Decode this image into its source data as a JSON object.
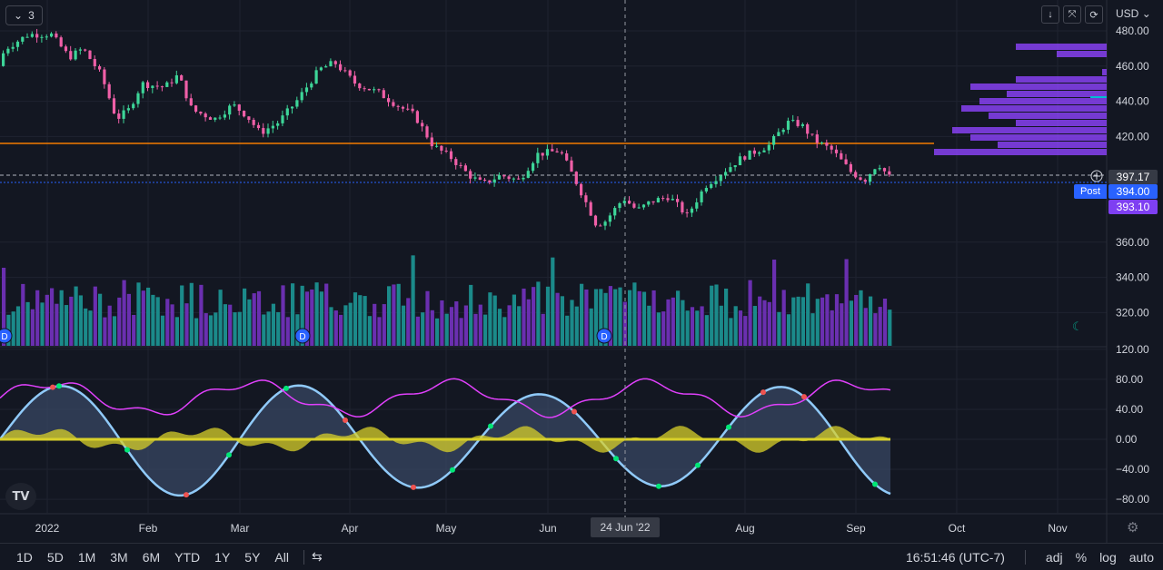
{
  "header": {
    "collapse_count": "3",
    "currency": "USD",
    "icons": [
      "arrow-down-icon",
      "collapse-icon",
      "reload-icon"
    ]
  },
  "price_axis": {
    "labels": [
      "480.00",
      "460.00",
      "440.00",
      "420.00",
      "360.00",
      "340.00",
      "320.00"
    ],
    "values": [
      480,
      460,
      440,
      420,
      360,
      340,
      320
    ]
  },
  "indicator_axis": {
    "labels": [
      "120.00",
      "80.00",
      "40.00",
      "0.00",
      "−40.00",
      "−80.00"
    ],
    "values": [
      120,
      80,
      40,
      0,
      -40,
      -80
    ]
  },
  "price_tags": {
    "last": "397.17",
    "post": "394.00",
    "post_label": "Post",
    "other": "393.10"
  },
  "time_axis": {
    "labels": [
      "2022",
      "Feb",
      "Mar",
      "Apr",
      "May",
      "Jun",
      "Aug",
      "Sep",
      "Oct",
      "Nov"
    ],
    "crosshair_date": "24 Jun '22"
  },
  "dividend_marker": "D",
  "bottom_toolbar": {
    "ranges": [
      "1D",
      "5D",
      "1M",
      "3M",
      "6M",
      "YTD",
      "1Y",
      "5Y",
      "All"
    ],
    "time": "16:51:46 (UTC-7)",
    "adj": "adj",
    "percent": "%",
    "log": "log",
    "auto": "auto"
  },
  "colors": {
    "bg": "#131722",
    "up": "#26a69a",
    "up_bright": "#3dd598",
    "down": "#ef5fa7",
    "orange_line": "#f57c00",
    "volume_profile": "#8e44ff",
    "tag_blue": "#2962ff",
    "tag_purple": "#7e3ff2",
    "wave_blue": "#90caf9",
    "wave_fill": "#3a4a66",
    "yellow": "#d8d02a",
    "magenta": "#e040fb",
    "red": "#ef2d2d",
    "green": "#76ff03"
  }
}
